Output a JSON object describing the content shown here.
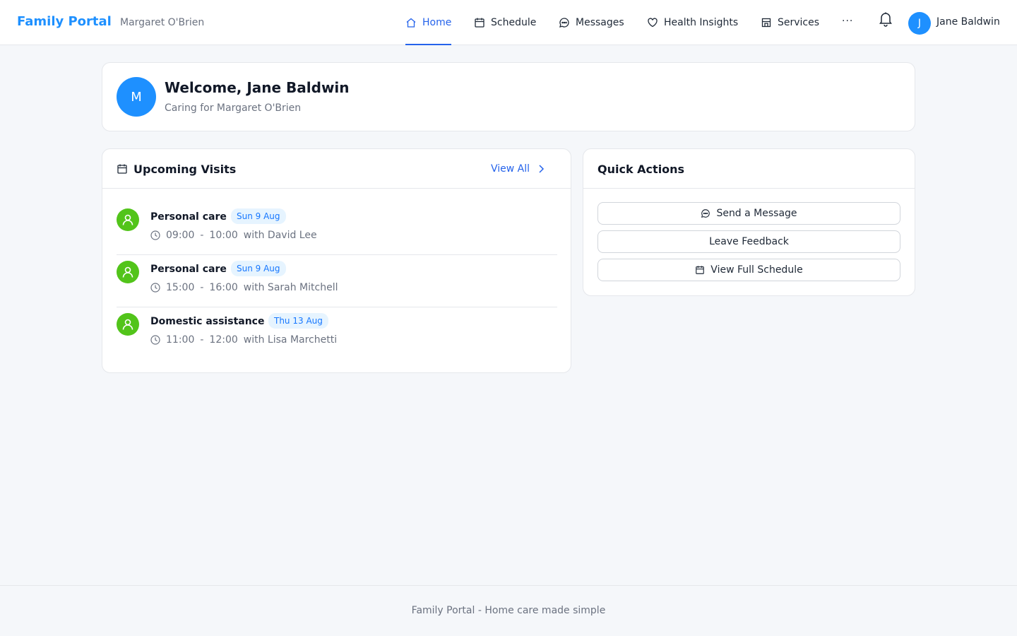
{
  "header": {
    "brand": "Family Portal",
    "recipient": "Margaret O'Brien",
    "nav": [
      {
        "label": "Home",
        "icon": "home-icon",
        "active": true
      },
      {
        "label": "Schedule",
        "icon": "calendar-icon"
      },
      {
        "label": "Messages",
        "icon": "message-icon"
      },
      {
        "label": "Health Insights",
        "icon": "heart-icon"
      },
      {
        "label": "Services",
        "icon": "shop-icon"
      }
    ],
    "more": "···",
    "user_initial": "J",
    "user_name": "Jane Baldwin"
  },
  "welcome": {
    "avatar": "M",
    "title": "Welcome, Jane Baldwin",
    "subtitle": "Caring for Margaret O'Brien"
  },
  "visits": {
    "title": "Upcoming Visits",
    "view_all": "View All",
    "items": [
      {
        "type": "Personal care",
        "date": "Sun 9 Aug",
        "start": "09:00",
        "end": "10:00",
        "carer": "with David Lee"
      },
      {
        "type": "Personal care",
        "date": "Sun 9 Aug",
        "start": "15:00",
        "end": "16:00",
        "carer": "with Sarah Mitchell"
      },
      {
        "type": "Domestic assistance",
        "date": "Thu 13 Aug",
        "start": "11:00",
        "end": "12:00",
        "carer": "with Lisa Marchetti"
      }
    ]
  },
  "quick_actions": {
    "title": "Quick Actions",
    "send_message": "Send a Message",
    "feedback": "Leave Feedback",
    "schedule": "View Full Schedule"
  },
  "footer": "Family Portal - Home care made simple",
  "colors": {
    "brand": "#1e90ff",
    "accent": "#2563eb",
    "visit_icon": "#52c41a",
    "badge_bg": "#e6f4ff"
  }
}
